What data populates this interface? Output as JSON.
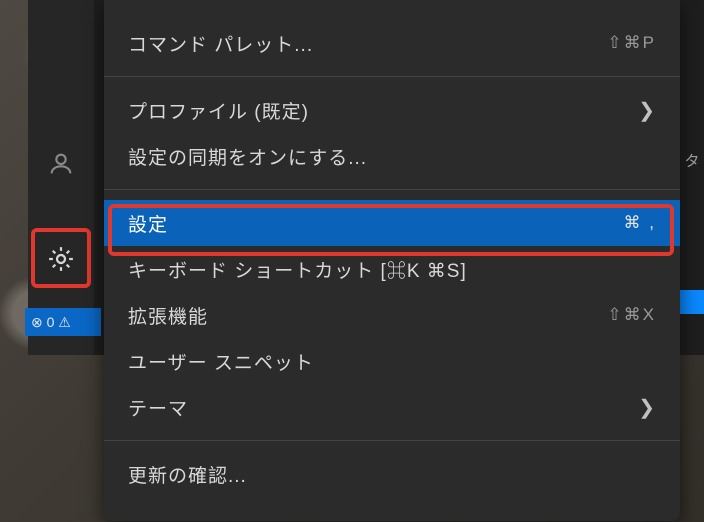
{
  "activity": {
    "account_icon": "account-icon",
    "settings_icon": "gear-icon"
  },
  "status": {
    "errors_warnings": "⊗ 0 ⚠"
  },
  "peek_text": "タ",
  "menu": {
    "items": [
      {
        "label": "コマンド パレット...",
        "shortcut": "⇧⌘P",
        "submenu": false
      },
      {
        "sep": true
      },
      {
        "label": "プロファイル (既定)",
        "shortcut": "",
        "submenu": true
      },
      {
        "label": "設定の同期をオンにする...",
        "shortcut": "",
        "submenu": false
      },
      {
        "sep": true
      },
      {
        "label": "設定",
        "shortcut": "⌘ ,",
        "submenu": false,
        "selected": true
      },
      {
        "label": "キーボード ショートカット [⌘K ⌘S]",
        "shortcut": "",
        "submenu": false
      },
      {
        "label": "拡張機能",
        "shortcut": "⇧⌘X",
        "submenu": false
      },
      {
        "label": "ユーザー スニペット",
        "shortcut": "",
        "submenu": false
      },
      {
        "label": "テーマ",
        "shortcut": "",
        "submenu": true
      },
      {
        "sep": true
      },
      {
        "label": "更新の確認...",
        "shortcut": "",
        "submenu": false
      }
    ]
  }
}
